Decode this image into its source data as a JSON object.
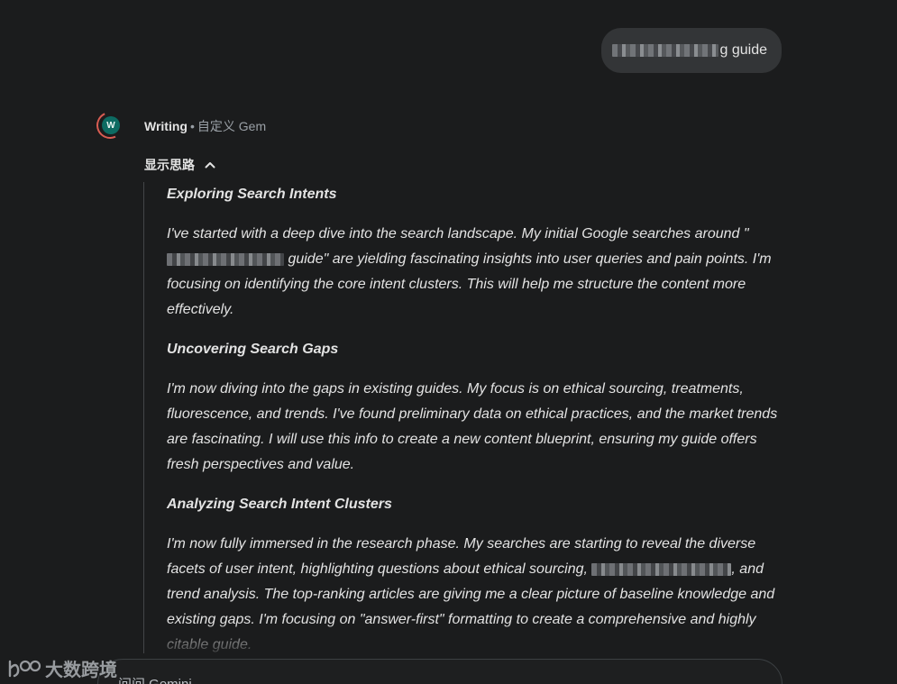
{
  "user_message": {
    "visible_suffix": "g guide"
  },
  "assistant": {
    "avatar_letter": "W",
    "gem_name": "Writing",
    "separator": "•",
    "gem_type": "自定义 Gem",
    "thinking_toggle_label": "显示思路"
  },
  "thoughts": [
    {
      "title": "Exploring Search Intents",
      "body_before": "I've started with a deep dive into the search landscape. My initial Google searches around \"",
      "body_after": " guide\" are yielding fascinating insights into user queries and pain points. I'm focusing on identifying the core intent clusters. This will help me structure the content more effectively."
    },
    {
      "title": "Uncovering Search Gaps",
      "body": "I'm now diving into the gaps in existing guides. My focus is on ethical sourcing, treatments, fluorescence, and trends.  I've found preliminary data on ethical practices, and the market trends are fascinating. I will use this info to create a new content blueprint, ensuring my guide offers fresh perspectives and value."
    },
    {
      "title": "Analyzing Search Intent Clusters",
      "body_before": "I'm now fully immersed in the research phase. My searches are starting to reveal the diverse facets of user intent, highlighting questions about ethical sourcing, ",
      "body_after": ", and trend analysis. The top-ranking articles are giving me a clear picture of baseline knowledge and existing gaps. I'm focusing on \"answer-first\" formatting to create a comprehensive and highly citable guide."
    }
  ],
  "input": {
    "placeholder": "问问 Gemini"
  },
  "watermark": {
    "text": "大数跨境"
  },
  "colors": {
    "background": "#1b1c1d",
    "bubble": "#333537",
    "avatar": "#0d6b62",
    "avatar_ring": "#d85c52",
    "text": "#e3e3e3",
    "muted": "#9aa0a6"
  }
}
